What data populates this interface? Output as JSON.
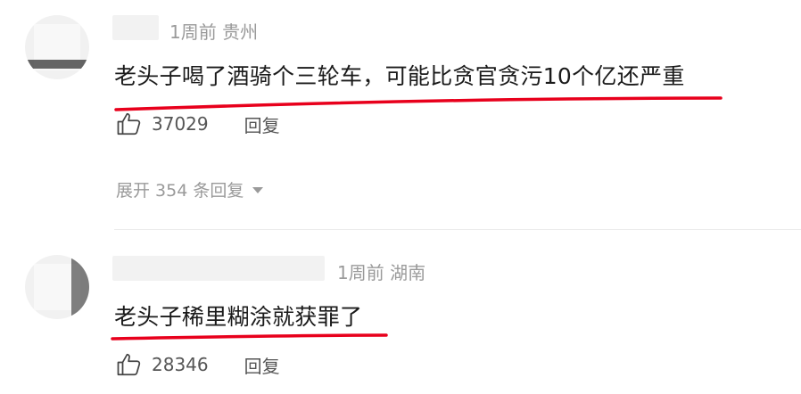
{
  "comments": [
    {
      "meta": "1周前 贵州",
      "text": "老头子喝了酒骑个三轮车，可能比贪官贪污10个亿还严重",
      "likes": "37029",
      "reply_label": "回复",
      "expand_label": "展开 354 条回复"
    },
    {
      "meta": "1周前 湖南",
      "text": "老头子稀里糊涂就获罪了",
      "likes": "28346",
      "reply_label": "回复"
    }
  ],
  "colors": {
    "annotation": "#e8001c",
    "meta": "#9a9a9a",
    "text": "#1a1a1a"
  },
  "icons": {
    "like": "thumbs-up-icon",
    "expand": "caret-down-icon"
  }
}
